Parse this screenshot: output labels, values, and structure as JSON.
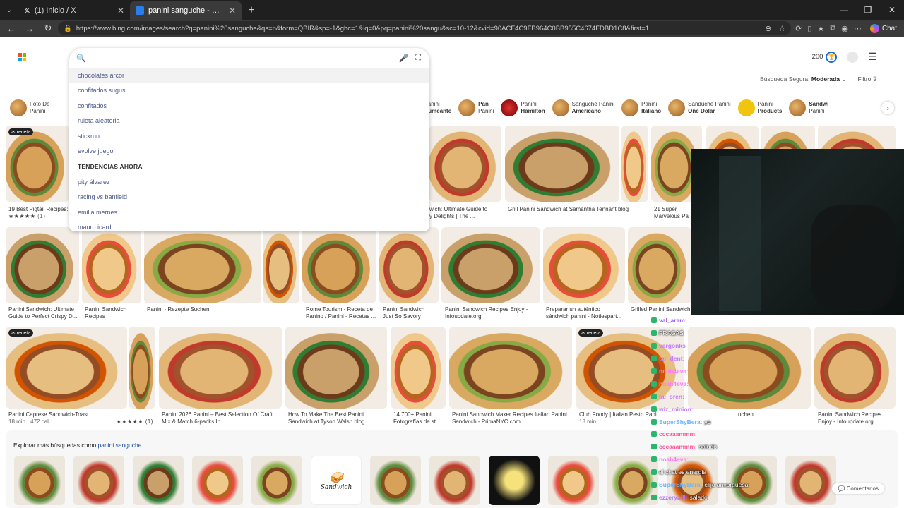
{
  "browser": {
    "tabs": [
      {
        "title": "(1) Inicio / X",
        "active": false
      },
      {
        "title": "panini sanguche - Búsqueda Imág",
        "active": true
      }
    ],
    "url": "https://www.bing.com/images/search?q=panini%20sanguche&qs=n&form=QBIR&sp=-1&ghc=1&lq=0&pq=panini%20sangu&sc=10-12&cvid=90ACF4C9FB964C0BB955C4674FDBD1C8&first=1",
    "copilot_label": "Chat"
  },
  "header": {
    "rewards_points": "200",
    "safe_search_label": "Búsqueda Segura:",
    "safe_search_value": "Moderada",
    "filter_label": "Filtro"
  },
  "search": {
    "value": "",
    "suggestions": [
      "chocolates arcor",
      "confitados sugus",
      "confitados",
      "ruleta aleatoria",
      "stickrun",
      "evolve juego"
    ],
    "trending_title": "TENDENCIAS AHORA",
    "trending": [
      "pity álvarez",
      "racing vs banfield",
      "emilia mernes",
      "mauro icardi"
    ]
  },
  "chips": [
    {
      "l1": "Foto De",
      "l2": "Panini"
    },
    {
      "l1": "Panini",
      "l2": "Humeante"
    },
    {
      "l1": "Pan",
      "l2": "Panini"
    },
    {
      "l1": "Panini",
      "l2": "Hamilton"
    },
    {
      "l1": "Sanguche Panini",
      "l2": "Americano"
    },
    {
      "l1": "Panini",
      "l2": "Italiano"
    },
    {
      "l1": "Sanduche Panini",
      "l2": "One Dolar"
    },
    {
      "l1": "Panini",
      "l2": "Products"
    },
    {
      "l1": "Sandwi",
      "l2": "Panini"
    }
  ],
  "row1_captions": [
    {
      "l1": "19 Best Pigtail Recipes: S",
      "stars": "★★★★★",
      "extra": "(1)"
    },
    {
      "l1": "wich: Ultimate Guide to",
      "l2": "y Delights | The ..."
    },
    {
      "l1": "Grill Panini Sandwich at Samantha Tennant blog"
    },
    {
      "l1": "21 Super",
      "l2": "Marvelous Pa"
    }
  ],
  "row2_captions": [
    {
      "l1": "Panini Sandwich: Ultimate",
      "l2": "Guide to Perfect Crispy D..."
    },
    {
      "l1": "Panini Sandwich",
      "l2": "Recipes"
    },
    {
      "l1": "Panini - Rezepte Suchen"
    },
    {
      "l1": "Rome Tourism - Receta de",
      "l2": "Panino / Panini - Recetas ..."
    },
    {
      "l1": "Panini Sandwich |",
      "l2": "Just So Savory"
    },
    {
      "l1": "Panini Sandwich Recipes Enjoy -",
      "l2": "Infoupdate.org"
    },
    {
      "l1": "Preparar un auténtico",
      "l2": "sándwich panini - Notiespart..."
    },
    {
      "l1": "Grilled Panini Sandwich"
    }
  ],
  "row3_captions": [
    {
      "l1": "Panini Caprese Sandwich-Toast",
      "l2": "18 min · 472 cal",
      "stars": "★★★★★",
      "extra": "(1)"
    },
    {
      "l1": "Panini 2026 Panini – Best Selection Of Craft",
      "l2": "Mix & Match 6-packs In ..."
    },
    {
      "l1": "How To Make The Best Panini",
      "l2": "Sandwich at Tyson Walsh blog"
    },
    {
      "l1": "14.700+ Panini",
      "l2": "Fotografías de st..."
    },
    {
      "l1": "Panini Sandwich Maker Recipes Italian Panini",
      "l2": "Sandwich - PrimaNYC.com"
    },
    {
      "l1": "Club Foody | Italian Pesto Pani",
      "l2": "18 min"
    },
    {
      "l1": "uchen"
    },
    {
      "l1": "Panini Sandwich Recipes",
      "l2": "Enjoy - Infoupdate.org"
    }
  ],
  "badges": {
    "receta": "receta"
  },
  "explore": {
    "prefix": "Explorar más búsquedas como ",
    "term": "panini sanguche",
    "logo_text": "Sandwich"
  },
  "feedback_label": "Comentarios",
  "chat": [
    {
      "user": "val_aram:",
      "text": "",
      "color": "#9b59ff"
    },
    {
      "user": "",
      "text": "FRAGAS",
      "color": "#7fd1ff"
    },
    {
      "user": "vargonks",
      "text": "",
      "color": "#c57bff"
    },
    {
      "user": "tar_dent:",
      "text": "",
      "color": "#c57bff"
    },
    {
      "user": "noah4eva:",
      "text": "",
      "color": "#ff77ff"
    },
    {
      "user": "noah4eva:",
      "text": "",
      "color": "#ff77ff"
    },
    {
      "user": "tal_oren:",
      "text": "",
      "color": "#c57bff"
    },
    {
      "user": "wiz_minion:",
      "text": "",
      "color": "#c57bff"
    },
    {
      "user": "SuperShyBera:",
      "text": "yo",
      "color": "#6cb3ff"
    },
    {
      "user": "cccaaammm:",
      "text": "",
      "color": "#ff5599"
    },
    {
      "user": "cccaaammm:",
      "text": "saludo",
      "color": "#ff5599"
    },
    {
      "user": "noah4eva:",
      "text": "",
      "color": "#ff77ff"
    },
    {
      "user": "",
      "text": "el chat es energia",
      "color": "#ffffff"
    },
    {
      "user": "SuperShyBera:",
      "text": "elijo anvorguesa",
      "color": "#6cb3ff"
    },
    {
      "user": "ezzeryalll:",
      "text": "salado",
      "color": "#b277ff"
    }
  ]
}
